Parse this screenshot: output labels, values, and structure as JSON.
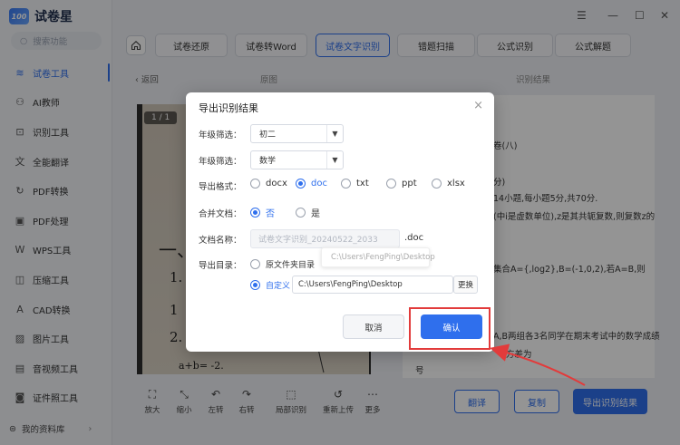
{
  "app": {
    "name": "试卷星",
    "logo_badge": "100",
    "search_placeholder": "搜索功能",
    "window_controls": [
      "☰",
      "—",
      "☐",
      "✕"
    ]
  },
  "sidebar": {
    "items": [
      {
        "label": "试卷工具",
        "icon": "layers-icon",
        "glyph": "≋",
        "active": true
      },
      {
        "label": "AI教师",
        "icon": "ai-teacher-icon",
        "glyph": "⚇"
      },
      {
        "label": "识别工具",
        "icon": "scan-icon",
        "glyph": "⊡"
      },
      {
        "label": "全能翻译",
        "icon": "translate-icon",
        "glyph": "文"
      },
      {
        "label": "PDF转换",
        "icon": "pdf-convert-icon",
        "glyph": "↻"
      },
      {
        "label": "PDF处理",
        "icon": "pdf-process-icon",
        "glyph": "▣"
      },
      {
        "label": "WPS工具",
        "icon": "wps-icon",
        "glyph": "W"
      },
      {
        "label": "压缩工具",
        "icon": "compress-icon",
        "glyph": "◫"
      },
      {
        "label": "CAD转换",
        "icon": "cad-icon",
        "glyph": "A"
      },
      {
        "label": "图片工具",
        "icon": "image-icon",
        "glyph": "▨"
      },
      {
        "label": "音视频工具",
        "icon": "video-icon",
        "glyph": "▤"
      },
      {
        "label": "证件照工具",
        "icon": "id-photo-icon",
        "glyph": "◙"
      }
    ],
    "footer": "我的资料库"
  },
  "tabs": [
    "试卷还原",
    "试卷转Word",
    "试卷文字识别",
    "错题扫描",
    "公式识别",
    "公式解题"
  ],
  "active_tab": "试卷文字识别",
  "subheader": {
    "back": "返回",
    "original": "原图",
    "result": "识别结果"
  },
  "image_panel": {
    "page_indicator": "1 / 1"
  },
  "result_lines": [
    "卷(八)",
    "分)",
    "14小题,每小题5分,共70分.",
    "(中i是虚数单位),z是其共轭复数,则复数z的",
    "集合A={,log2},B=(-1,0,2),若A=B,则",
    "A,B两组各3名同学在期末考试中的数学成绩",
    "方差为",
    "号"
  ],
  "bottom_tools": [
    {
      "label": "放大",
      "icon": "zoom-in-icon",
      "glyph": "⛶"
    },
    {
      "label": "缩小",
      "icon": "zoom-out-icon",
      "glyph": "⤡"
    },
    {
      "label": "左转",
      "icon": "rotate-left-icon",
      "glyph": "↶"
    },
    {
      "label": "右转",
      "icon": "rotate-right-icon",
      "glyph": "↷"
    },
    {
      "label": "局部识别",
      "icon": "crop-icon",
      "glyph": "⬚"
    },
    {
      "label": "重新上传",
      "icon": "reupload-icon",
      "glyph": "↺"
    },
    {
      "label": "更多",
      "icon": "more-icon",
      "glyph": "⋯"
    }
  ],
  "buttons": {
    "translate": "翻译",
    "copy": "复制",
    "export": "导出识别结果"
  },
  "dialog": {
    "title": "导出识别结果",
    "grade_label": "年级筛选：",
    "grade_value": "初二",
    "subject_label": "年级筛选：",
    "subject_value": "数学",
    "format_label": "导出格式：",
    "formats": [
      "docx",
      "doc",
      "txt",
      "ppt",
      "xlsx"
    ],
    "selected_format": "doc",
    "merge_label": "合并文档：",
    "merge_options": [
      "否",
      "是"
    ],
    "merge_selected": "否",
    "filename_label": "文档名称：",
    "filename_value": "试卷文字识别_20240522_2033",
    "filename_ext": ".doc",
    "dir_label": "导出目录：",
    "dir_option_source": "原文件夹目录",
    "dir_option_custom": "自定义",
    "source_path_tooltip": "C:\\Users\\FengPing\\Desktop",
    "custom_path": "C:\\Users\\FengPing\\Desktop",
    "change_button": "更换",
    "cancel": "取消",
    "confirm": "确认"
  },
  "colors": {
    "accent": "#2f6fed",
    "annotation": "#e23b3b"
  }
}
